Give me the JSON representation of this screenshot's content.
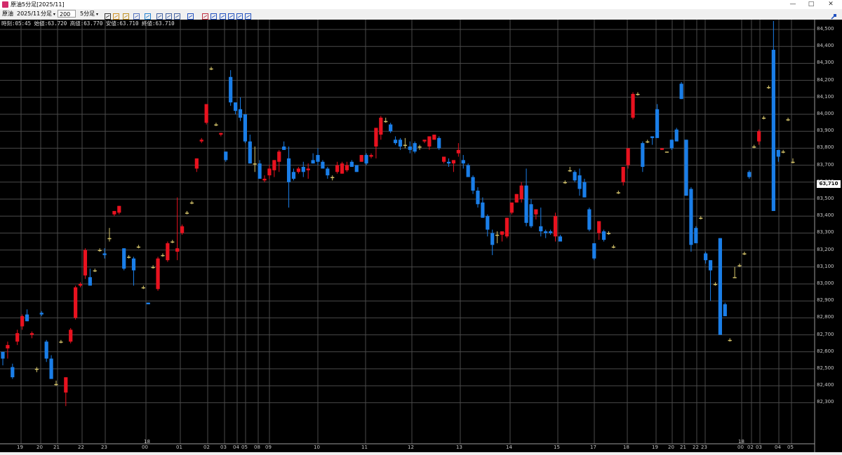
{
  "window": {
    "title": "原油5分足[2025/11]",
    "minimize": "—",
    "maximize": "□",
    "close": "✕"
  },
  "toolbar": {
    "symbol": "原油",
    "contract": "2025/11",
    "period_select": "分足",
    "count_value": "200",
    "interval_select": "5分足",
    "icons": [
      "cursor-icon",
      "hand-icon",
      "pencil-icon",
      "eraser-icon",
      "globe-icon",
      "window-icon",
      "grid-icon",
      "table-icon",
      "bar-chart-icon",
      "cross-chart-icon",
      "chart-icon-1",
      "chart-icon-2",
      "chart-icon-3",
      "chart-icon-4",
      "refresh-icon"
    ],
    "pin_icon": "pin-icon"
  },
  "info_line": "時刻:05:45 始値:63.720 高値:63.770 安値:63.710 終値:63.710",
  "colors": {
    "up": "#e8121f",
    "down": "#1a7ee8",
    "background": "#000000",
    "grid": "#4a4a4a",
    "doji": "#d4c36a"
  },
  "chart_data": {
    "type": "candlestick",
    "y_ticks": [
      "84,500",
      "84,400",
      "84,300",
      "84,200",
      "84,100",
      "84,000",
      "83,900",
      "83,800",
      "83,700",
      "83,600",
      "83,500",
      "83,400",
      "83,300",
      "83,200",
      "83,100",
      "83,000",
      "82,900",
      "82,800",
      "82,700",
      "82,600",
      "82,500",
      "82,400",
      "82,300"
    ],
    "ylim": [
      82.26,
      84.63
    ],
    "last_price": "63,710",
    "x_ticks": [
      "19",
      "20",
      "21",
      "22",
      "23",
      "00",
      "01",
      "02",
      "03",
      "04",
      "05",
      "08",
      "09",
      "10",
      "11",
      "12",
      "13",
      "14",
      "15",
      "17",
      "18",
      "19",
      "20",
      "21",
      "22",
      "23",
      "00",
      "02",
      "03",
      "04",
      "05"
    ],
    "x_marks": [
      "18",
      "18"
    ],
    "candles": [
      [
        82.6,
        82.58,
        82.52,
        82.56
      ],
      [
        82.62,
        82.66,
        82.56,
        82.64
      ],
      [
        82.51,
        82.53,
        82.44,
        82.45
      ],
      [
        82.66,
        82.73,
        82.64,
        82.71
      ],
      [
        82.75,
        82.82,
        82.73,
        82.81
      ],
      [
        82.82,
        82.85,
        82.78,
        82.78
      ],
      [
        82.7,
        82.72,
        82.68,
        82.71
      ],
      [
        82.5,
        82.51,
        82.48,
        82.5
      ],
      [
        82.83,
        82.84,
        82.81,
        82.82
      ],
      [
        82.66,
        82.67,
        82.54,
        82.56
      ],
      [
        82.56,
        82.58,
        82.44,
        82.44
      ],
      [
        82.41,
        82.43,
        82.4,
        82.41
      ],
      [
        82.66,
        82.67,
        82.65,
        82.66
      ],
      [
        82.36,
        82.45,
        82.28,
        82.45
      ],
      [
        82.66,
        82.74,
        82.65,
        82.73
      ],
      [
        82.8,
        82.99,
        82.79,
        82.98
      ],
      [
        82.99,
        83.01,
        82.98,
        83.0
      ],
      [
        83.05,
        83.21,
        83.03,
        83.2
      ],
      [
        83.04,
        83.09,
        82.99,
        82.99
      ],
      [
        83.08,
        83.09,
        83.07,
        83.08
      ],
      [
        83.2,
        83.21,
        83.19,
        83.2
      ],
      [
        83.18,
        83.21,
        83.15,
        83.17
      ],
      [
        83.27,
        83.33,
        83.25,
        83.27
      ],
      [
        83.41,
        83.43,
        83.4,
        83.43
      ],
      [
        83.42,
        83.46,
        83.41,
        83.46
      ],
      [
        83.21,
        83.21,
        83.08,
        83.09
      ],
      [
        83.16,
        83.17,
        83.15,
        83.16
      ],
      [
        83.15,
        83.16,
        82.99,
        83.08
      ],
      [
        83.22,
        83.23,
        83.21,
        83.22
      ],
      [
        82.98,
        82.99,
        82.97,
        82.98
      ],
      [
        82.89,
        82.89,
        82.88,
        82.88
      ],
      [
        83.1,
        83.11,
        83.09,
        83.1
      ],
      [
        82.97,
        83.16,
        82.96,
        83.15
      ],
      [
        83.17,
        83.18,
        83.16,
        83.17
      ],
      [
        83.14,
        83.25,
        83.13,
        83.24
      ],
      [
        83.25,
        83.26,
        83.24,
        83.25
      ],
      [
        83.19,
        83.51,
        83.14,
        83.21
      ],
      [
        83.3,
        83.35,
        83.29,
        83.34
      ],
      [
        83.42,
        83.43,
        83.41,
        83.42
      ],
      [
        83.48,
        83.49,
        83.47,
        83.48
      ],
      [
        83.68,
        83.74,
        83.66,
        83.74
      ],
      [
        83.84,
        83.86,
        83.83,
        83.85
      ],
      [
        83.95,
        84.06,
        83.94,
        84.06
      ],
      [
        84.27,
        84.28,
        84.26,
        84.27
      ],
      [
        83.94,
        83.95,
        83.93,
        83.94
      ],
      [
        83.88,
        83.89,
        83.87,
        83.89
      ],
      [
        83.78,
        83.78,
        83.72,
        83.73
      ],
      [
        84.22,
        84.26,
        84.05,
        84.07
      ],
      [
        84.07,
        84.07,
        84.0,
        84.02
      ],
      [
        84.03,
        84.1,
        83.96,
        83.98
      ],
      [
        84.0,
        84.0,
        83.83,
        83.84
      ],
      [
        83.84,
        83.88,
        83.71,
        83.71
      ],
      [
        83.71,
        83.81,
        83.66,
        83.71
      ],
      [
        83.71,
        83.73,
        83.62,
        83.62
      ],
      [
        83.61,
        83.64,
        83.6,
        83.62
      ],
      [
        83.64,
        83.7,
        83.62,
        83.68
      ],
      [
        83.67,
        83.73,
        83.63,
        83.73
      ],
      [
        83.72,
        83.79,
        83.66,
        83.78
      ],
      [
        83.81,
        83.84,
        83.79,
        83.79
      ],
      [
        83.74,
        83.81,
        83.45,
        83.6
      ],
      [
        83.66,
        83.68,
        83.61,
        83.62
      ],
      [
        83.66,
        83.69,
        83.65,
        83.68
      ],
      [
        83.69,
        83.72,
        83.63,
        83.66
      ],
      [
        83.67,
        83.71,
        83.62,
        83.68
      ],
      [
        83.73,
        83.77,
        83.71,
        83.71
      ],
      [
        83.76,
        83.8,
        83.7,
        83.72
      ],
      [
        83.72,
        83.73,
        83.7,
        83.68
      ],
      [
        83.68,
        83.69,
        83.62,
        83.64
      ],
      [
        83.63,
        83.64,
        83.61,
        83.63
      ],
      [
        83.66,
        83.72,
        83.65,
        83.7
      ],
      [
        83.65,
        83.72,
        83.65,
        83.71
      ],
      [
        83.67,
        83.72,
        83.66,
        83.7
      ],
      [
        83.72,
        83.73,
        83.69,
        83.69
      ],
      [
        83.7,
        83.7,
        83.66,
        83.66
      ],
      [
        83.72,
        83.76,
        83.72,
        83.76
      ],
      [
        83.76,
        83.77,
        83.7,
        83.71
      ],
      [
        83.75,
        83.77,
        83.74,
        83.76
      ],
      [
        83.81,
        83.89,
        83.74,
        83.92
      ],
      [
        83.88,
        83.99,
        83.85,
        83.98
      ],
      [
        83.96,
        83.98,
        83.95,
        83.96
      ],
      [
        83.94,
        83.95,
        83.89,
        83.9
      ],
      [
        83.85,
        83.87,
        83.82,
        83.83
      ],
      [
        83.85,
        83.86,
        83.79,
        83.81
      ],
      [
        83.82,
        83.86,
        83.8,
        83.82
      ],
      [
        83.81,
        83.84,
        83.77,
        83.79
      ],
      [
        83.83,
        83.84,
        83.77,
        83.78
      ],
      [
        83.81,
        83.82,
        83.79,
        83.81
      ],
      [
        83.84,
        83.85,
        83.83,
        83.85
      ],
      [
        83.81,
        83.87,
        83.79,
        83.87
      ],
      [
        83.85,
        83.88,
        83.85,
        83.88
      ],
      [
        83.86,
        83.87,
        83.79,
        83.8
      ],
      [
        83.72,
        83.75,
        83.71,
        83.75
      ],
      [
        83.72,
        83.74,
        83.69,
        83.71
      ],
      [
        83.71,
        83.72,
        83.66,
        83.73
      ],
      [
        83.77,
        83.83,
        83.75,
        83.79
      ],
      [
        83.73,
        83.76,
        83.68,
        83.71
      ],
      [
        83.7,
        83.71,
        83.63,
        83.63
      ],
      [
        83.63,
        83.64,
        83.53,
        83.55
      ],
      [
        83.55,
        83.57,
        83.45,
        83.47
      ],
      [
        83.48,
        83.51,
        83.39,
        83.39
      ],
      [
        83.4,
        83.41,
        83.28,
        83.32
      ],
      [
        83.3,
        83.32,
        83.17,
        83.23
      ],
      [
        83.29,
        83.31,
        83.24,
        83.29
      ],
      [
        83.29,
        83.31,
        83.25,
        83.31
      ],
      [
        83.28,
        83.39,
        83.27,
        83.39
      ],
      [
        83.42,
        83.44,
        83.41,
        83.48
      ],
      [
        83.48,
        83.53,
        83.48,
        83.53
      ],
      [
        83.5,
        83.6,
        83.48,
        83.58
      ],
      [
        83.58,
        83.68,
        83.34,
        83.36
      ],
      [
        83.47,
        83.5,
        83.33,
        83.34
      ],
      [
        83.41,
        83.44,
        83.38,
        83.44
      ],
      [
        83.34,
        83.45,
        83.28,
        83.31
      ],
      [
        83.31,
        83.32,
        83.27,
        83.3
      ],
      [
        83.31,
        83.32,
        83.29,
        83.3
      ],
      [
        83.28,
        83.42,
        83.25,
        83.4
      ],
      [
        83.28,
        83.29,
        83.25,
        83.25
      ],
      [
        83.6,
        83.61,
        83.59,
        83.6
      ],
      [
        83.67,
        83.69,
        83.66,
        83.67
      ],
      [
        83.66,
        83.67,
        83.6,
        83.61
      ],
      [
        83.64,
        83.68,
        83.52,
        83.56
      ],
      [
        83.6,
        83.62,
        83.51,
        83.51
      ],
      [
        83.44,
        83.45,
        83.31,
        83.32
      ],
      [
        83.24,
        83.24,
        83.14,
        83.15
      ],
      [
        83.3,
        83.37,
        83.26,
        83.37
      ],
      [
        83.31,
        83.32,
        83.25,
        83.26
      ],
      [
        83.3,
        83.31,
        83.29,
        83.3
      ],
      [
        83.22,
        83.23,
        83.21,
        83.22
      ],
      [
        83.54,
        83.55,
        83.53,
        83.54
      ],
      [
        83.6,
        83.69,
        83.58,
        83.69
      ],
      [
        83.7,
        83.8,
        83.68,
        83.8
      ],
      [
        83.98,
        84.13,
        83.97,
        84.12
      ],
      [
        84.12,
        84.13,
        84.11,
        84.12
      ],
      [
        83.83,
        83.84,
        83.66,
        83.69
      ],
      [
        83.84,
        83.85,
        83.83,
        83.84
      ],
      [
        83.87,
        83.87,
        83.82,
        83.86
      ],
      [
        84.03,
        84.06,
        83.86,
        83.86
      ],
      [
        83.79,
        83.8,
        83.79,
        83.8
      ],
      [
        83.78,
        83.78,
        83.78,
        83.78
      ],
      [
        83.85,
        83.85,
        83.79,
        83.8
      ],
      [
        83.91,
        83.92,
        83.87,
        83.84
      ],
      [
        84.18,
        84.19,
        84.09,
        84.09
      ],
      [
        83.85,
        83.85,
        83.52,
        83.52
      ],
      [
        83.56,
        83.57,
        83.19,
        83.23
      ],
      [
        83.33,
        83.34,
        83.26,
        83.24
      ],
      [
        83.39,
        83.4,
        83.38,
        83.39
      ],
      [
        83.18,
        83.19,
        83.12,
        83.14
      ],
      [
        83.14,
        83.14,
        82.9,
        83.08
      ],
      [
        83.0,
        83.01,
        82.99,
        83.0
      ],
      [
        83.27,
        83.27,
        82.7,
        82.7
      ],
      [
        82.88,
        82.89,
        82.81,
        82.81
      ],
      [
        82.67,
        82.68,
        82.66,
        82.67
      ],
      [
        83.04,
        83.04,
        83.1,
        83.04
      ],
      [
        83.11,
        83.12,
        83.1,
        83.11
      ],
      [
        83.18,
        83.19,
        83.17,
        83.18
      ],
      [
        83.66,
        83.67,
        83.62,
        83.63
      ],
      [
        83.81,
        83.82,
        83.8,
        83.81
      ],
      [
        83.84,
        83.91,
        83.82,
        83.9
      ],
      [
        83.98,
        83.99,
        83.97,
        83.98
      ],
      [
        84.16,
        84.17,
        84.15,
        84.16
      ],
      [
        84.38,
        84.55,
        83.43,
        83.43
      ],
      [
        83.79,
        83.79,
        83.72,
        83.75
      ],
      [
        83.78,
        83.79,
        83.77,
        83.78
      ],
      [
        83.97,
        83.98,
        83.96,
        83.97
      ],
      [
        83.72,
        83.74,
        83.71,
        83.72
      ]
    ]
  }
}
